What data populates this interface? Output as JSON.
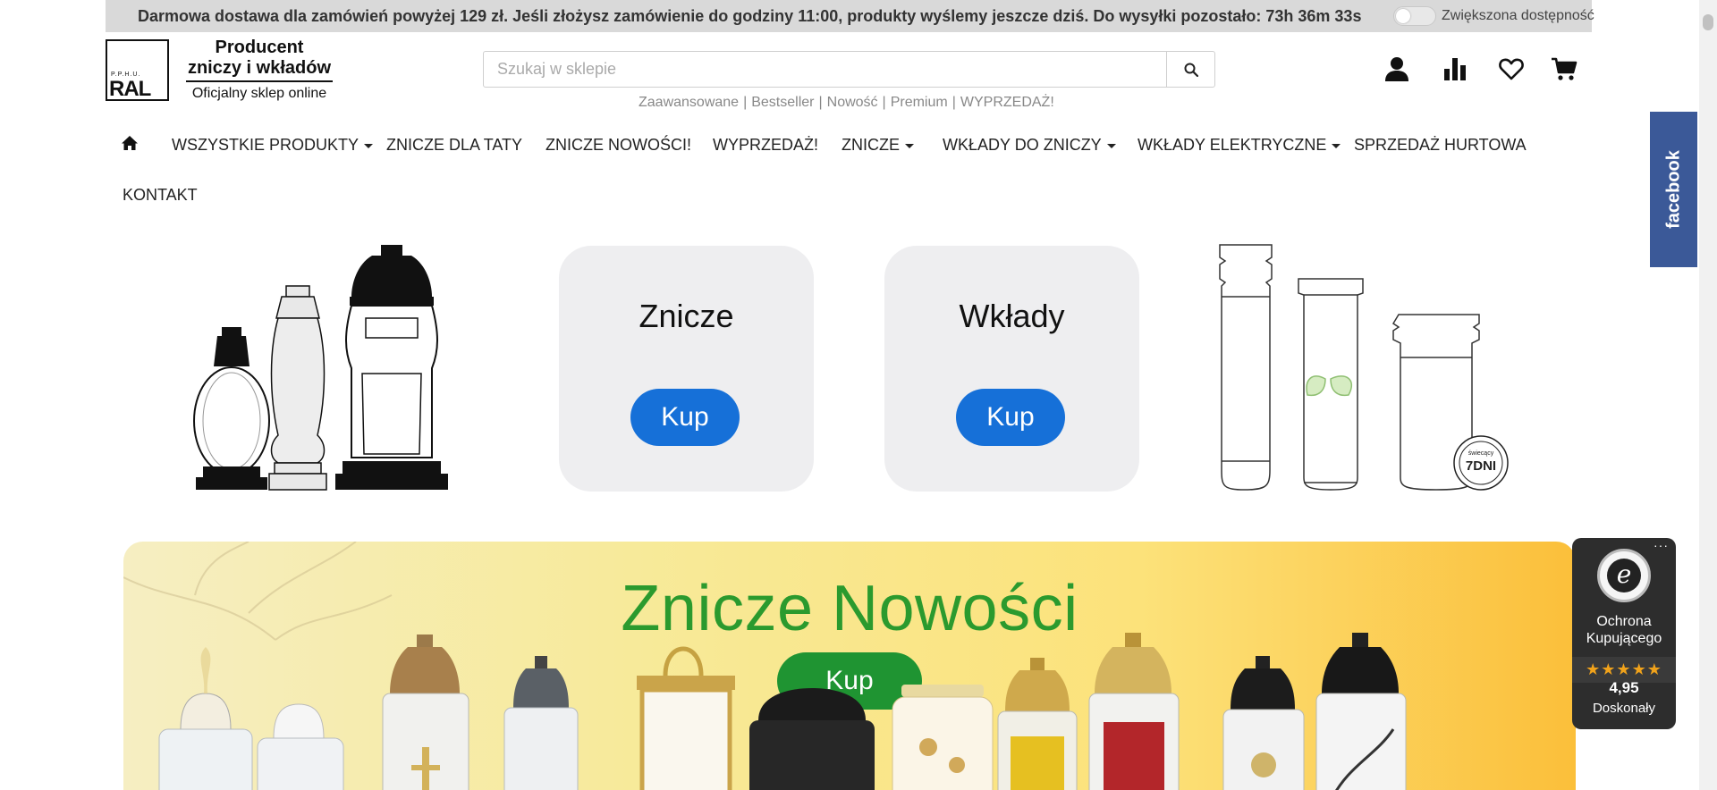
{
  "promo": {
    "text": "Darmowa dostawa dla zamówień powyżej 129 zł. Jeśli złożysz zamówienie do godziny 11:00, produkty wyślemy jeszcze dziś. Do wysyłki pozostało: 73h 36m 33s",
    "accessibility_label": "Zwiększona dostępność",
    "accessibility_enabled": false
  },
  "logo": {
    "ppuh": "P.P.H.U.",
    "brand": "RAL",
    "tagline_line1": "Producent",
    "tagline_line2": "zniczy i wkładów",
    "tagline_line3": "Oficjalny sklep online"
  },
  "search": {
    "placeholder": "Szukaj w sklepie",
    "value": "",
    "button_icon": "search-icon"
  },
  "quick_links": [
    "Zaawansowane",
    "Bestseller",
    "Nowość",
    "Premium",
    "WYPRZEDAŻ!"
  ],
  "header_icons": [
    {
      "name": "account-icon"
    },
    {
      "name": "compare-icon"
    },
    {
      "name": "wishlist-icon"
    },
    {
      "name": "cart-icon"
    }
  ],
  "nav": {
    "home_icon": "home-icon",
    "items": [
      {
        "label": "WSZYSTKIE PRODUKTY",
        "dropdown": true
      },
      {
        "label": "ZNICZE DLA TATY",
        "dropdown": false
      },
      {
        "label": "ZNICZE NOWOŚCI!",
        "dropdown": false
      },
      {
        "label": "WYPRZEDAŻ!",
        "dropdown": false
      },
      {
        "label": "ZNICZE",
        "dropdown": true
      },
      {
        "label": "WKŁADY DO ZNICZY",
        "dropdown": true
      },
      {
        "label": "WKŁADY ELEKTRYCZNE",
        "dropdown": true
      },
      {
        "label": "SPRZEDAŻ HURTOWA",
        "dropdown": false
      },
      {
        "label": "KONTAKT",
        "dropdown": false
      }
    ]
  },
  "facebook_tab": {
    "label": "facebook",
    "color": "#3b5998"
  },
  "categories": [
    {
      "title": "Znicze",
      "button": "Kup"
    },
    {
      "title": "Wkłady",
      "button": "Kup"
    }
  ],
  "inserts_badge": {
    "line1": "świecący",
    "line2": "7DNI"
  },
  "banner": {
    "title": "Znicze Nowości",
    "button": "Kup",
    "title_color": "#2b9a2e",
    "button_color": "#1f9432"
  },
  "trusted_shops": {
    "line1": "Ochrona",
    "line2": "Kupującego",
    "stars": "★★★★★",
    "score": "4,95",
    "rating_word": "Doskonały",
    "menu": "···",
    "seal_letter": "e"
  },
  "colors": {
    "accent_blue": "#1670d8",
    "promo_bar": "#d9d9d9",
    "card_bg": "#eeeef0"
  }
}
